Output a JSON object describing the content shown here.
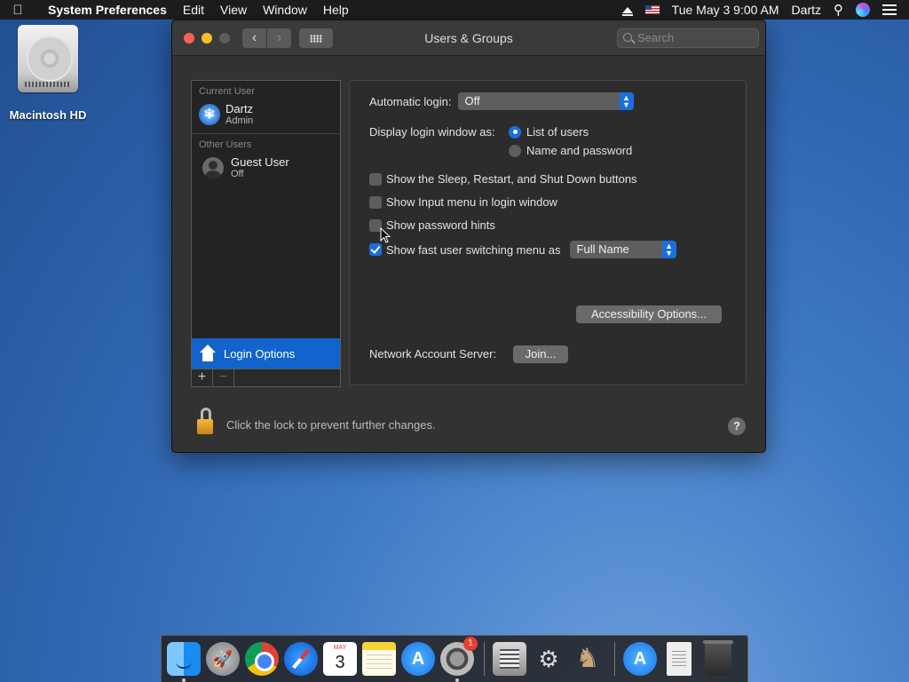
{
  "menubar": {
    "app_name": "System Preferences",
    "items": [
      "Edit",
      "View",
      "Window",
      "Help"
    ],
    "clock": "Tue May 3  9:00 AM",
    "user": "Dartz"
  },
  "desktop": {
    "drive_label": "Macintosh HD"
  },
  "window": {
    "title": "Users & Groups",
    "search_placeholder": "Search"
  },
  "sidebar": {
    "current_user_header": "Current User",
    "current_user": {
      "name": "Dartz",
      "role": "Admin"
    },
    "other_users_header": "Other Users",
    "other_users": [
      {
        "name": "Guest User",
        "role": "Off"
      }
    ],
    "selected_item": "Login Options",
    "add_label": "+",
    "remove_label": "−"
  },
  "login_options": {
    "automatic_login_label": "Automatic login:",
    "automatic_login_value": "Off",
    "display_login_label": "Display login window as:",
    "display_options": [
      "List of users",
      "Name and password"
    ],
    "display_selected": "List of users",
    "checkboxes": [
      {
        "label": "Show the Sleep, Restart, and Shut Down buttons",
        "checked": false
      },
      {
        "label": "Show Input menu in login window",
        "checked": false
      },
      {
        "label": "Show password hints",
        "checked": false
      },
      {
        "label": "Show fast user switching menu as",
        "checked": true
      }
    ],
    "fast_user_switching_value": "Full Name",
    "accessibility_button": "Accessibility Options...",
    "network_server_label": "Network Account Server:",
    "join_button": "Join..."
  },
  "footer": {
    "lock_text": "Click the lock to prevent further changes.",
    "help_label": "?"
  },
  "dock": {
    "calendar_month": "MAY",
    "calendar_day": "3",
    "sysprefs_badge": "1",
    "appstore_glyph": "A",
    "downloads_glyph": "A"
  },
  "colors": {
    "accent": "#1a6fe0",
    "selection": "#1263cb",
    "window_bg": "#323232",
    "desktop": "#2a5ea8"
  }
}
